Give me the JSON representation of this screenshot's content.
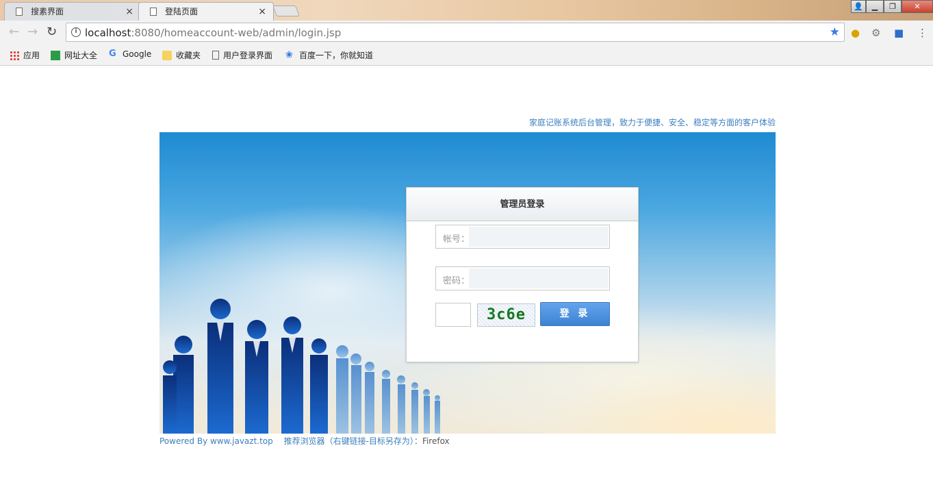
{
  "browser": {
    "tabs": [
      {
        "title": "搜素界面",
        "active": false
      },
      {
        "title": "登陆页面",
        "active": true
      }
    ],
    "url_host": "localhost",
    "url_rest": ":8080/homeaccount-web/admin/login.jsp",
    "bookmarks": [
      "应用",
      "网址大全",
      "Google",
      "收藏夹",
      "用户登录界面",
      "百度一下，你就知道"
    ]
  },
  "page": {
    "slogan": "家庭记账系统后台管理，致力于便捷、安全、稳定等方面的客户体验",
    "login": {
      "title": "管理员登录",
      "account_label": "帐号：",
      "password_label": "密码：",
      "captcha_text": "3c6e",
      "button_label": "登 录"
    },
    "footer": {
      "powered": "Powered By www.javazt.top",
      "recommend": "推荐浏览器（右键链接-目标另存为）：",
      "browser": "Firefox"
    }
  },
  "colors": {
    "accent": "#3d82d3",
    "link": "#3d7fbf",
    "captcha": "#117a22"
  }
}
